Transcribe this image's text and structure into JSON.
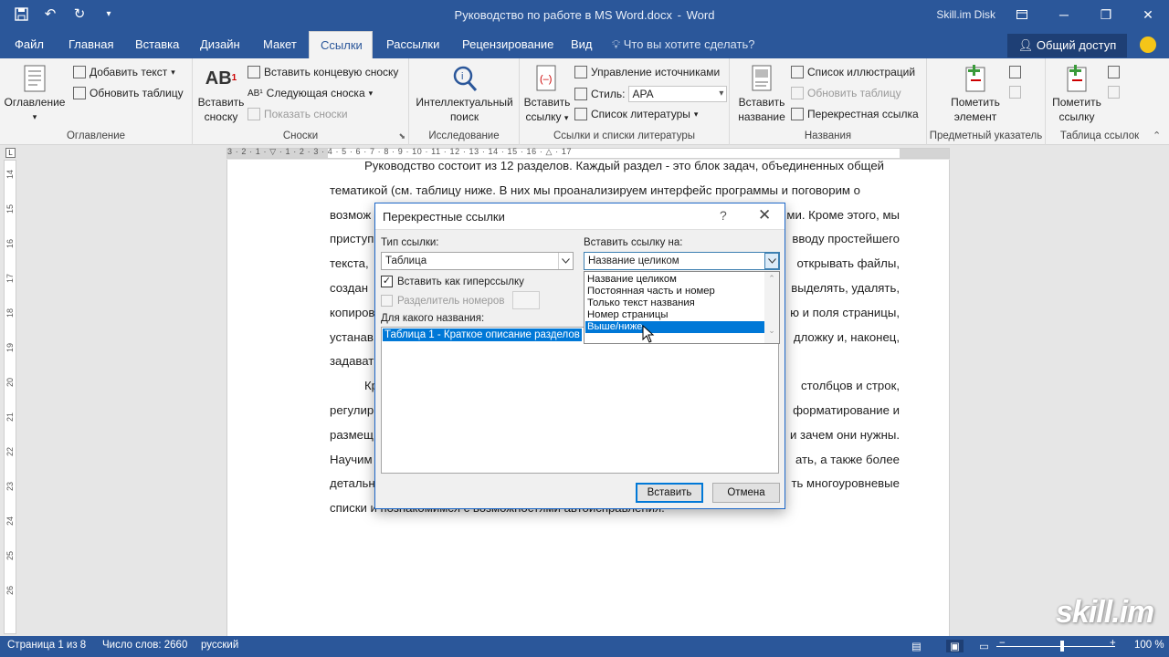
{
  "window": {
    "title": "Руководство по работе в MS Word.docx",
    "app": "Word",
    "account": "Skill.im Disk"
  },
  "tabs": [
    "Файл",
    "Главная",
    "Вставка",
    "Дизайн",
    "Макет",
    "Ссылки",
    "Рассылки",
    "Рецензирование",
    "Вид"
  ],
  "active_tab": "Ссылки",
  "tell_me": "Что вы хотите сделать?",
  "share": "Общий доступ",
  "ribbon": {
    "toc": {
      "big": "Оглавление",
      "add_text": "Добавить текст",
      "update_table": "Обновить таблицу",
      "group": "Оглавление"
    },
    "footnotes": {
      "big1": "Вставить",
      "big2": "сноску",
      "endnote": "Вставить концевую сноску",
      "next": "Следующая сноска",
      "show": "Показать сноски",
      "group": "Сноски"
    },
    "research": {
      "big1": "Интеллектуальный",
      "big2": "поиск",
      "group": "Исследование"
    },
    "citations": {
      "big1": "Вставить",
      "big2": "ссылку",
      "manage": "Управление источниками",
      "style_label": "Стиль:",
      "style_value": "APA",
      "biblio": "Список литературы",
      "group": "Ссылки и списки литературы"
    },
    "captions": {
      "big1": "Вставить",
      "big2": "название",
      "figures": "Список иллюстраций",
      "update": "Обновить таблицу",
      "crossref": "Перекрестная ссылка",
      "group": "Названия"
    },
    "index": {
      "big1": "Пометить",
      "big2": "элемент",
      "group": "Предметный указатель"
    },
    "toa": {
      "big1": "Пометить",
      "big2": "ссылку",
      "group": "Таблица ссылок"
    }
  },
  "ruler": {
    "numbers": "3 · 2 · 1 · ▽ · 1 · 2 · 3 · 4 · 5 · 6 · 7 · 8 · 9 · 10 · 11 · 12 · 13 · 14 · 15 · 16 · △ · 17"
  },
  "vruler": [
    "14",
    "13",
    "15",
    "16",
    "17",
    "18",
    "19",
    "20",
    "21",
    "22",
    "23",
    "24",
    "25",
    "26"
  ],
  "document": {
    "lines": [
      "Руководство состоит из 12 разделов. Каждый раздел - это блок задач, объединенных общей",
      "тематикой (см. таблицу ниже. В них мы проанализируем интерфейс программы и поговорим о",
      "возмож",
      "приступ",
      "текста,",
      "создан",
      "копиров",
      "устанав",
      "задават",
      "Кр",
      "регулир",
      "размещ",
      "Научим",
      "детальн",
      "списки и познакомимся с возможностями автоисправления."
    ],
    "right_frags": [
      "",
      "",
      "ми. Кроме этого, мы",
      "вводу простейшего",
      "открывать файлы,",
      "выделять, удалять,",
      "ю и поля страницы,",
      "дложку и, наконец,",
      "",
      "столбцов и строк,",
      "форматирование и",
      "и зачем они нужны.",
      "ать, а также более",
      "ть многоуровневые",
      ""
    ]
  },
  "dialog": {
    "title": "Перекрестные ссылки",
    "help": "?",
    "close": "✕",
    "ref_type_label": "Тип ссылки:",
    "ref_type_value": "Таблица",
    "insert_ref_label": "Вставить ссылку на:",
    "insert_ref_value": "Название целиком",
    "hyperlink_label": "Вставить как гиперссылку",
    "separator_label": "Разделитель номеров",
    "for_which_label": "Для какого названия:",
    "list_item": "Таблица 1 - Краткое описание разделов",
    "dropdown_options": [
      "Название целиком",
      "Постоянная часть и номер",
      "Только текст названия",
      "Номер страницы",
      "Выше/ниже"
    ],
    "dropdown_selected": "Выше/ниже",
    "insert_btn": "Вставить",
    "cancel_btn": "Отмена"
  },
  "status": {
    "page": "Страница 1 из 8",
    "words": "Число слов: 2660",
    "lang": "русский",
    "zoom": "100 %"
  },
  "watermark": "skill.im",
  "colors": {
    "brand": "#2b579a",
    "select": "#0078d7"
  }
}
